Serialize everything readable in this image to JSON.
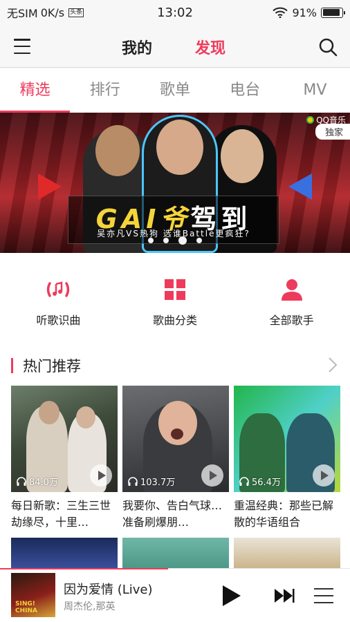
{
  "status_bar": {
    "carrier": "无SIM",
    "net_speed": "0K/s",
    "notification_badge": "头条",
    "time": "13:02",
    "battery_percent": "91%",
    "battery_level": 0.91,
    "icons": [
      "wifi-icon",
      "battery-icon"
    ]
  },
  "top_nav": {
    "mine_label": "我的",
    "discover_label": "发现",
    "active_color": "#ee3b5c",
    "icons": [
      "menu-icon",
      "search-icon"
    ]
  },
  "tabs": [
    {
      "label": "精选",
      "active": true
    },
    {
      "label": "排行",
      "active": false
    },
    {
      "label": "歌单",
      "active": false
    },
    {
      "label": "电台",
      "active": false
    },
    {
      "label": "MV",
      "active": false
    }
  ],
  "banner": {
    "title_gai": "GAI爷",
    "title_rest": "驾到",
    "subtitle": "吴亦凡VS热狗   选谁Battle更疯狂?",
    "brand": "QQ音乐",
    "exclusive": "独家",
    "page_count": 4,
    "active_index": 2
  },
  "quick_entries": [
    {
      "label": "听歌识曲",
      "icon": "music-recognize-icon"
    },
    {
      "label": "歌曲分类",
      "icon": "grid-category-icon"
    },
    {
      "label": "全部歌手",
      "icon": "singer-icon"
    }
  ],
  "hot": {
    "title": "热门推荐",
    "accent": "#ee3b5c",
    "cards": [
      {
        "count": "84.0万",
        "title": "每日新歌：三生三世劫缘尽，十里…"
      },
      {
        "count": "103.7万",
        "title": "我要你、告白气球…准备刷爆朋…"
      },
      {
        "count": "56.4万",
        "title": "重温经典：那些已解散的华语组合"
      }
    ]
  },
  "player": {
    "song": "因为爱情 (Live)",
    "artist": "周杰伦,那英",
    "cover_text": "SING! CHINA",
    "progress": 0.48
  }
}
